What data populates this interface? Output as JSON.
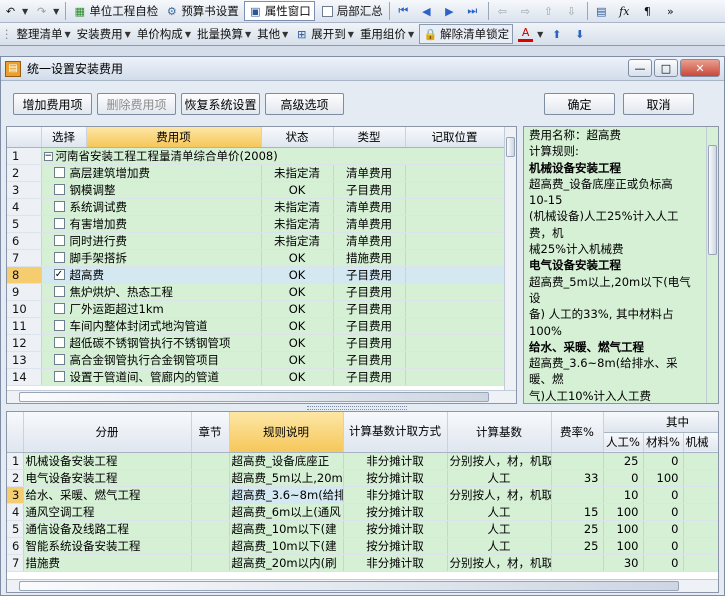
{
  "toolbar1": {
    "items": [
      "单位工程自检",
      "预算书设置",
      "属性窗口",
      "局部汇总"
    ]
  },
  "toolbar2": {
    "items": [
      "整理清单",
      "安装费用",
      "单价构成",
      "批量换算",
      "其他",
      "展开到",
      "重用组价",
      "解除清单锁定"
    ]
  },
  "dialog": {
    "title": "统一设置安装费用",
    "buttons": {
      "add": "增加费用项",
      "delete": "删除费用项",
      "restore": "恢复系统设置",
      "advanced": "高级选项",
      "ok": "确定",
      "cancel": "取消"
    },
    "top_grid": {
      "headers": [
        "选择",
        "费用项",
        "状态",
        "类型",
        "记取位置"
      ],
      "rows": [
        {
          "n": "1",
          "name": "河南省安装工程工程量清单综合单价(2008)",
          "status": "",
          "type": "",
          "loc": ""
        },
        {
          "n": "2",
          "name": "高层建筑增加费",
          "status": "未指定清",
          "type": "清单费用",
          "loc": ""
        },
        {
          "n": "3",
          "name": "钢模调整",
          "status": "OK",
          "type": "子目费用",
          "loc": ""
        },
        {
          "n": "4",
          "name": "系统调试费",
          "status": "未指定清",
          "type": "清单费用",
          "loc": ""
        },
        {
          "n": "5",
          "name": "有害增加费",
          "status": "未指定清",
          "type": "清单费用",
          "loc": ""
        },
        {
          "n": "6",
          "name": "同时进行费",
          "status": "未指定清",
          "type": "清单费用",
          "loc": ""
        },
        {
          "n": "7",
          "name": "脚手架搭拆",
          "status": "OK",
          "type": "措施费用",
          "loc": ""
        },
        {
          "n": "8",
          "name": "超高费",
          "status": "OK",
          "type": "子目费用",
          "loc": ""
        },
        {
          "n": "9",
          "name": "焦炉烘炉、热态工程",
          "status": "OK",
          "type": "子目费用",
          "loc": ""
        },
        {
          "n": "10",
          "name": "厂外运距超过1km",
          "status": "OK",
          "type": "子目费用",
          "loc": ""
        },
        {
          "n": "11",
          "name": "车间内整体封闭式地沟管道",
          "status": "OK",
          "type": "子目费用",
          "loc": ""
        },
        {
          "n": "12",
          "name": "超低碳不锈钢管执行不锈钢管项",
          "status": "OK",
          "type": "子目费用",
          "loc": ""
        },
        {
          "n": "13",
          "name": "高合金钢管执行合金钢管项目",
          "status": "OK",
          "type": "子目费用",
          "loc": ""
        },
        {
          "n": "14",
          "name": "设置于管道间、管廊内的管道",
          "status": "OK",
          "type": "子目费用",
          "loc": ""
        }
      ]
    },
    "info_panel": {
      "lines": [
        {
          "t": "费用名称：超高费",
          "b": false
        },
        {
          "t": "计算规则:",
          "b": false
        },
        {
          "t": "机械设备安装工程",
          "b": true
        },
        {
          "t": "超高费_设备底座正或负标高",
          "b": false
        },
        {
          "t": "10-15",
          "b": false
        },
        {
          "t": "(机械设备)人工25%计入人工",
          "b": false
        },
        {
          "t": "费，机",
          "b": false
        },
        {
          "t": "械25%计入机械费",
          "b": false
        },
        {
          "t": "电气设备安装工程",
          "b": true
        },
        {
          "t": "超高费_5m以上,20m以下(电气",
          "b": false
        },
        {
          "t": "设",
          "b": false
        },
        {
          "t": "备) 人工的33%, 其中材料占",
          "b": false
        },
        {
          "t": "100%",
          "b": false
        },
        {
          "t": "给水、采暖、燃气工程",
          "b": true
        },
        {
          "t": "超高费_3.6~8m(给排水、采",
          "b": false
        },
        {
          "t": "暖、燃",
          "b": false
        },
        {
          "t": "气)人工10%计入人工费",
          "b": false
        }
      ]
    },
    "bottom_grid": {
      "headers": {
        "cebie": "分册",
        "zhangjie": "章节",
        "rule": "规则说明",
        "method": "计算基数计取方式",
        "base": "计算基数",
        "rate": "费率%",
        "qizhong": "其中",
        "labor": "人工%",
        "material": "材料%",
        "machine": "机械"
      },
      "rows": [
        {
          "n": "1",
          "cebie": "机械设备安装工程",
          "rule": "超高费_设备底座正",
          "method": "非分摊计取",
          "base": "分别按人，材，机取费",
          "rate": "",
          "labor": "25",
          "material": "0",
          "machine": ""
        },
        {
          "n": "2",
          "cebie": "电气设备安装工程",
          "rule": "超高费_5m以上,20m",
          "method": "按分摊计取",
          "base": "人工",
          "rate": "33",
          "labor": "0",
          "material": "100",
          "machine": ""
        },
        {
          "n": "3",
          "cebie": "给水、采暖、燃气工程",
          "rule": "超高费_3.6~8m(给排",
          "method": "非分摊计取",
          "base": "分别按人，材，机取费",
          "rate": "",
          "labor": "10",
          "material": "0",
          "machine": ""
        },
        {
          "n": "4",
          "cebie": "通风空调工程",
          "rule": "超高费_6m以上(通风",
          "method": "按分摊计取",
          "base": "人工",
          "rate": "15",
          "labor": "100",
          "material": "0",
          "machine": ""
        },
        {
          "n": "5",
          "cebie": "通信设备及线路工程",
          "rule": "超高费_10m以下(建",
          "method": "按分摊计取",
          "base": "人工",
          "rate": "25",
          "labor": "100",
          "material": "0",
          "machine": ""
        },
        {
          "n": "6",
          "cebie": "智能系统设备安装工程",
          "rule": "超高费_10m以下(建",
          "method": "按分摊计取",
          "base": "人工",
          "rate": "25",
          "labor": "100",
          "material": "0",
          "machine": ""
        },
        {
          "n": "7",
          "cebie": "措施费",
          "rule": "超高费_20m以内(刷",
          "method": "非分摊计取",
          "base": "分别按人，材，机取费",
          "rate": "",
          "labor": "30",
          "material": "0",
          "machine": ""
        }
      ]
    }
  }
}
